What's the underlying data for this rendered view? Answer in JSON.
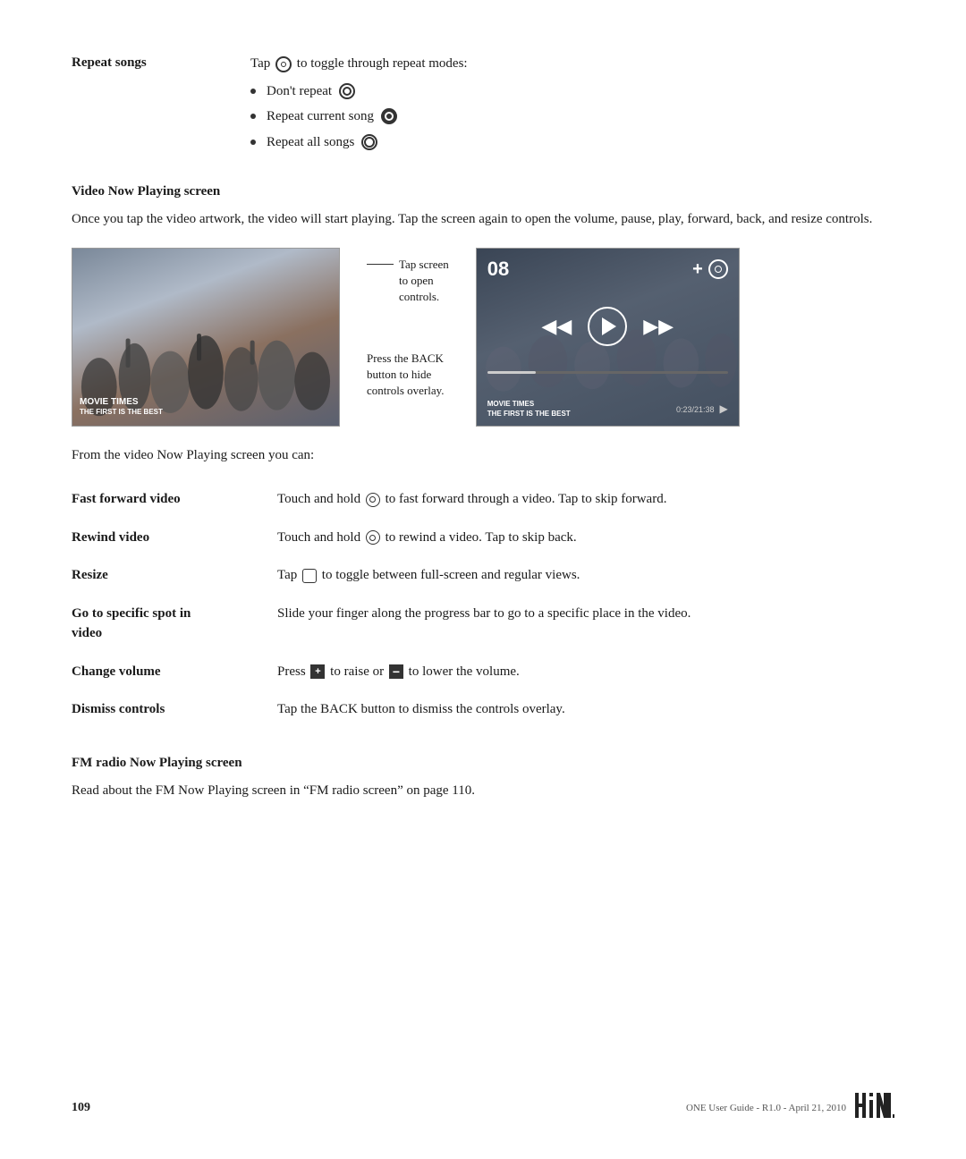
{
  "page": {
    "number": "109",
    "footer_text": "ONE User Guide - R1.0 - April 21, 2010"
  },
  "repeat_songs": {
    "label": "Repeat songs",
    "intro": "Tap Ⓡ to toggle through repeat modes:",
    "items": [
      {
        "text": "Don't repeat",
        "icon": "repeat-none"
      },
      {
        "text": "Repeat current song",
        "icon": "repeat-current"
      },
      {
        "text": "Repeat all songs",
        "icon": "repeat-all"
      }
    ]
  },
  "video_section": {
    "heading": "Video Now Playing screen",
    "body": "Once you tap the video artwork, the video will start playing. Tap the screen again to open the volume, pause, play, forward, back, and resize controls.",
    "annotation1_line1": "Tap screen",
    "annotation1_line2": "to open",
    "annotation1_line3": "controls.",
    "annotation2_line1": "Press the BACK",
    "annotation2_line2": "button to hide",
    "annotation2_line3": "controls overlay.",
    "movie_title": "MOVIE TIMES",
    "movie_subtitle": "THE FIRST IS THE BEST",
    "time_code": "0:23/21:38",
    "from_screen_text": "From the video Now Playing screen you can:",
    "controls_time": "08"
  },
  "features": [
    {
      "label": "Fast forward video",
      "description": "Touch and hold Ⓡ to fast forward through a video. Tap to skip forward."
    },
    {
      "label": "Rewind video",
      "description": "Touch and hold Ⓡ to rewind a video. Tap to skip back."
    },
    {
      "label": "Resize",
      "description": "Tap Ⓡ to toggle between full-screen and regular views."
    },
    {
      "label": "Go to specific spot in video",
      "description": "Slide your finger along the progress bar to go to a specific place in the video."
    },
    {
      "label": "Change volume",
      "description": "Press + to raise or − to lower the volume."
    },
    {
      "label": "Dismiss controls",
      "description": "Tap the BACK button to dismiss the controls overlay."
    }
  ],
  "fm_radio": {
    "heading": "FM radio Now Playing screen",
    "body": "Read about the FM Now Playing screen in “FM radio screen” on page 110."
  }
}
